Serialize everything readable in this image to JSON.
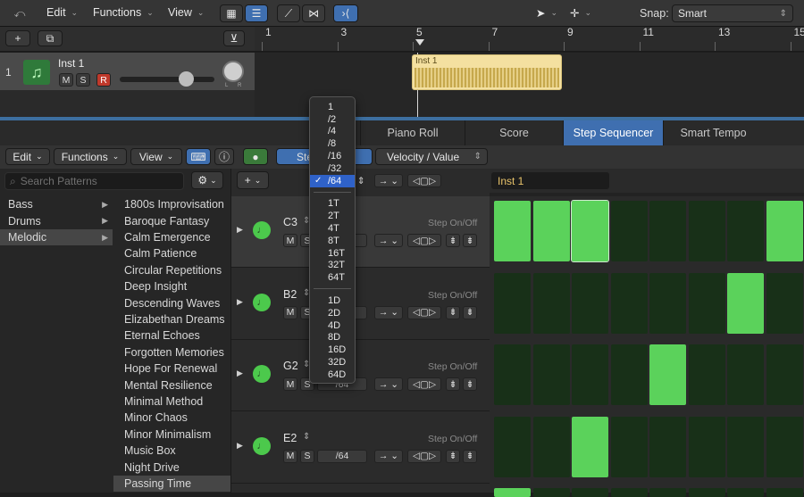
{
  "toolbar": {
    "edit": "Edit",
    "functions": "Functions",
    "view": "View",
    "snap_label": "Snap:",
    "snap_value": "Smart"
  },
  "ruler": {
    "marks": [
      "1",
      "3",
      "5",
      "7",
      "9",
      "11",
      "13",
      "15"
    ]
  },
  "track": {
    "number": "1",
    "name": "Inst 1",
    "mute": "M",
    "solo": "S",
    "record": "R",
    "pan_l": "L",
    "pan_r": "R"
  },
  "region": {
    "name": "Inst 1"
  },
  "tabs": [
    "Piano Roll",
    "Score",
    "Step Sequencer",
    "Smart Tempo"
  ],
  "active_tab": "Step Sequencer",
  "editor": {
    "edit": "Edit",
    "functions": "Functions",
    "view": "View",
    "step_btn": "Step",
    "velocity": "Velocity / Value",
    "pattern_name": "Inst 1",
    "add": "+"
  },
  "browser": {
    "search_placeholder": "Search Patterns",
    "categories": [
      "Bass",
      "Drums",
      "Melodic"
    ],
    "selected_category": "Melodic",
    "patterns": [
      "1800s Improvisation",
      "Baroque Fantasy",
      "Calm Emergence",
      "Calm Patience",
      "Circular Repetitions",
      "Deep Insight",
      "Descending Waves",
      "Elizabethan Dreams",
      "Eternal Echoes",
      "Forgotten Memories",
      "Hope For Renewal",
      "Mental Resilience",
      "Minimal Method",
      "Minor Chaos",
      "Minor Minimalism",
      "Music Box",
      "Night Drive",
      "Passing Time"
    ],
    "selected_pattern": "Passing Time"
  },
  "rows": [
    {
      "pitch": "C3",
      "mute": "M",
      "solo": "S",
      "rate": "/64",
      "step_label": "Step On/Off"
    },
    {
      "pitch": "B2",
      "mute": "M",
      "solo": "S",
      "rate": "/64",
      "step_label": "Step On/Off"
    },
    {
      "pitch": "G2",
      "mute": "M",
      "solo": "S",
      "rate": "/64",
      "step_label": "Step On/Off"
    },
    {
      "pitch": "E2",
      "mute": "M",
      "solo": "S",
      "rate": "/64",
      "step_label": "Step On/Off"
    }
  ],
  "steps": [
    [
      1,
      1,
      1,
      0,
      0,
      0,
      0,
      1
    ],
    [
      0,
      0,
      0,
      0,
      0,
      0,
      1,
      0
    ],
    [
      0,
      0,
      0,
      0,
      1,
      0,
      0,
      0
    ],
    [
      0,
      0,
      1,
      0,
      0,
      0,
      0,
      0
    ]
  ],
  "menu": {
    "selected": "/64",
    "groups": [
      [
        "1",
        "/2",
        "/4",
        "/8",
        "/16",
        "/32",
        "/64"
      ],
      [
        "1T",
        "2T",
        "4T",
        "8T",
        "16T",
        "32T",
        "64T"
      ],
      [
        "1D",
        "2D",
        "4D",
        "8D",
        "16D",
        "32D",
        "64D"
      ]
    ]
  },
  "colors": {
    "accent": "#3f6fb0",
    "step_on": "#5bd25b",
    "step_off": "#183018",
    "menu_highlight": "#2f62c9"
  }
}
